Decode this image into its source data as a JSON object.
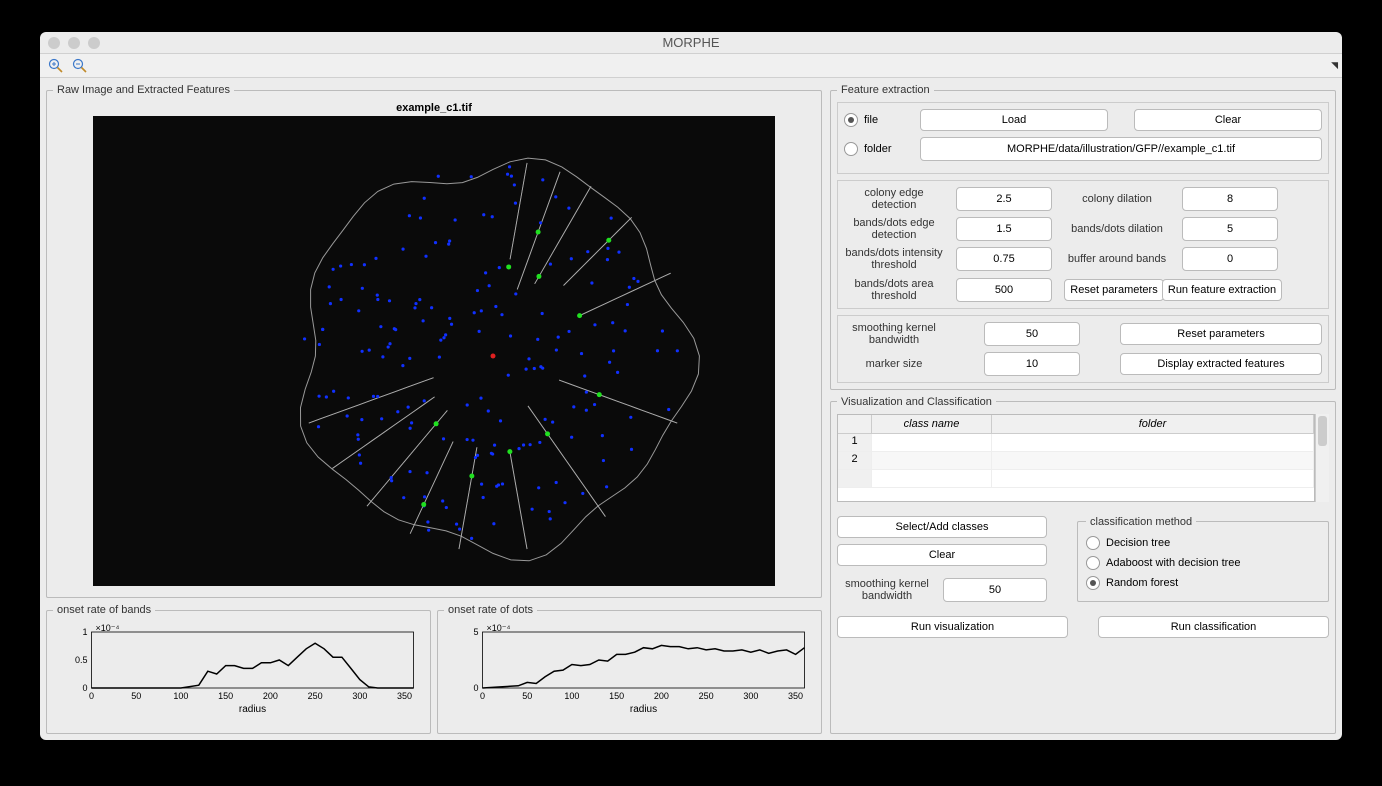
{
  "window": {
    "title": "MORPHE"
  },
  "left": {
    "panel_title": "Raw Image and Extracted Features",
    "image_title": "example_c1.tif",
    "plot1": {
      "title": "onset rate of bands",
      "xlabel": "radius"
    },
    "plot2": {
      "title": "onset rate of dots",
      "xlabel": "radius"
    }
  },
  "fx": {
    "title": "Feature extraction",
    "file_label": "file",
    "folder_label": "folder",
    "load": "Load",
    "clear": "Clear",
    "path": "MORPHE/data/illustration/GFP//example_c1.tif",
    "colony_edge": "colony edge detection",
    "colony_edge_v": "2.5",
    "colony_dil": "colony dilation",
    "colony_dil_v": "8",
    "bd_edge": "bands/dots edge detection",
    "bd_edge_v": "1.5",
    "bd_dil": "bands/dots dilation",
    "bd_dil_v": "5",
    "bd_int": "bands/dots intensity threshold",
    "bd_int_v": "0.75",
    "buf": "buffer around bands",
    "buf_v": "0",
    "bd_area": "bands/dots area threshold",
    "bd_area_v": "500",
    "reset": "Reset parameters",
    "run": "Run feature extraction",
    "skb": "smoothing kernel bandwidth",
    "skb_v": "50",
    "marker": "marker size",
    "marker_v": "10",
    "reset2": "Reset parameters",
    "disp": "Display extracted features"
  },
  "viz": {
    "title": "Visualization and Classification",
    "col1": "class name",
    "col2": "folder",
    "r1": "1",
    "r2": "2",
    "select": "Select/Add classes",
    "clear": "Clear",
    "skb": "smoothing kernel bandwidth",
    "skb_v": "50",
    "cm_title": "classification method",
    "dt": "Decision tree",
    "ada": "Adaboost with decision tree",
    "rf": "Random forest",
    "runv": "Run visualization",
    "runc": "Run classification"
  },
  "chart_data": [
    {
      "type": "line",
      "title": "onset rate of bands",
      "xlabel": "radius",
      "ylabel": "",
      "xlim": [
        0,
        360
      ],
      "ylim": [
        0,
        0.0001
      ],
      "y_tick_labels": [
        "0",
        "0.5",
        "1"
      ],
      "y_exponent": "×10⁻⁴",
      "x_ticks": [
        0,
        50,
        100,
        150,
        200,
        250,
        300,
        350
      ],
      "x": [
        0,
        20,
        40,
        60,
        80,
        100,
        120,
        130,
        140,
        150,
        160,
        170,
        180,
        190,
        200,
        210,
        220,
        230,
        240,
        250,
        260,
        270,
        280,
        290,
        300,
        310,
        320,
        340,
        360
      ],
      "y": [
        0,
        0,
        0,
        0,
        0,
        0,
        5e-06,
        3e-05,
        2.5e-05,
        4e-05,
        4e-05,
        3.5e-05,
        3.5e-05,
        4.5e-05,
        4.5e-05,
        5e-05,
        4e-05,
        5.5e-05,
        7e-05,
        8e-05,
        7e-05,
        5.5e-05,
        5.5e-05,
        3.5e-05,
        1.5e-05,
        2e-06,
        0,
        0,
        0
      ]
    },
    {
      "type": "line",
      "title": "onset rate of dots",
      "xlabel": "radius",
      "ylabel": "",
      "xlim": [
        0,
        360
      ],
      "ylim": [
        0,
        0.0005
      ],
      "y_tick_labels": [
        "0",
        "5"
      ],
      "y_exponent": "×10⁻⁴",
      "x_ticks": [
        0,
        50,
        100,
        150,
        200,
        250,
        300,
        350
      ],
      "x": [
        0,
        20,
        40,
        50,
        60,
        70,
        80,
        90,
        100,
        110,
        120,
        130,
        140,
        150,
        160,
        170,
        180,
        190,
        200,
        210,
        220,
        230,
        240,
        250,
        260,
        270,
        280,
        290,
        300,
        310,
        320,
        330,
        340,
        350,
        360
      ],
      "y": [
        0,
        1e-05,
        2e-05,
        5e-05,
        4e-05,
        0.0001,
        0.00015,
        0.00016,
        0.00021,
        0.0002,
        0.00021,
        0.00025,
        0.00024,
        0.0003,
        0.0003,
        0.00032,
        0.00036,
        0.00035,
        0.00038,
        0.00037,
        0.00037,
        0.00035,
        0.00036,
        0.00034,
        0.00035,
        0.00033,
        0.00033,
        0.00034,
        0.00032,
        0.00034,
        0.00031,
        0.00033,
        0.00034,
        0.0003,
        0.00036
      ]
    }
  ]
}
